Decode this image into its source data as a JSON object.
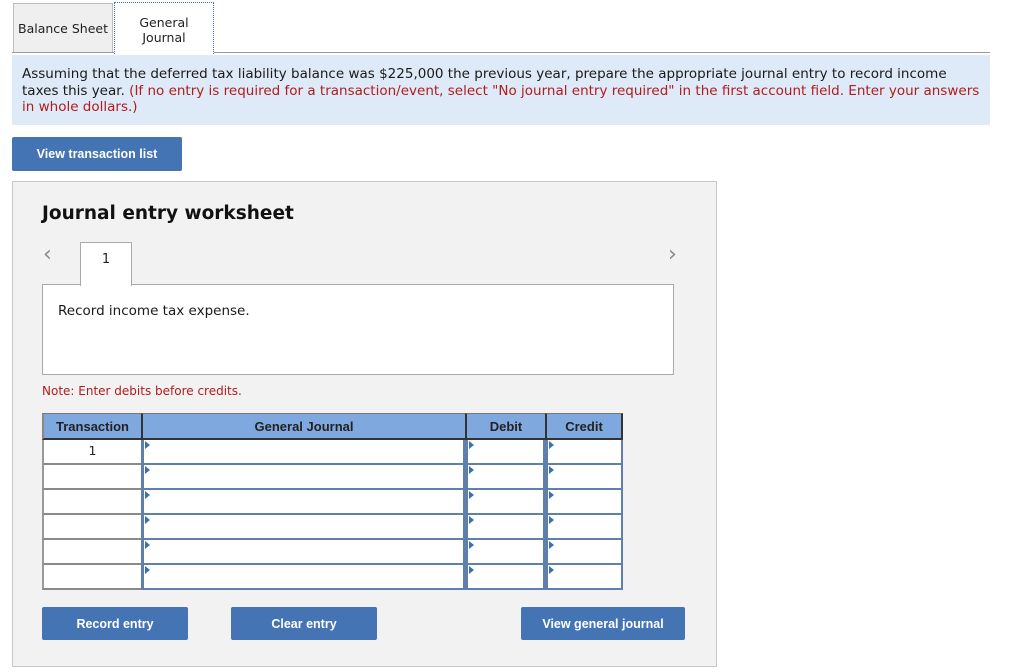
{
  "tabs": [
    {
      "label": "Balance Sheet",
      "active": false
    },
    {
      "label": "General\nJournal",
      "active": true
    }
  ],
  "instructions": {
    "text": "Assuming that the deferred tax liability balance was $225,000 the previous year, prepare the appropriate journal entry to record income taxes this year.",
    "hint": "(If no entry is required for a transaction/event, select \"No journal entry required\" in the first account field. Enter your answers in whole dollars.)"
  },
  "buttons": {
    "view_transaction_list": "View transaction list",
    "record_entry": "Record entry",
    "clear_entry": "Clear entry",
    "view_general_journal": "View general journal"
  },
  "worksheet": {
    "title": "Journal entry worksheet",
    "prev_icon": "chevron-left-icon",
    "next_icon": "chevron-right-icon",
    "current_entry": "1",
    "entry_description": "Record income tax expense.",
    "note": "Note: Enter debits before credits."
  },
  "table": {
    "headers": [
      "Transaction",
      "General Journal",
      "Debit",
      "Credit"
    ],
    "rows": [
      {
        "transaction": "1",
        "account": "",
        "debit": "",
        "credit": ""
      },
      {
        "transaction": "",
        "account": "",
        "debit": "",
        "credit": ""
      },
      {
        "transaction": "",
        "account": "",
        "debit": "",
        "credit": ""
      },
      {
        "transaction": "",
        "account": "",
        "debit": "",
        "credit": ""
      },
      {
        "transaction": "",
        "account": "",
        "debit": "",
        "credit": ""
      },
      {
        "transaction": "",
        "account": "",
        "debit": "",
        "credit": ""
      }
    ]
  },
  "colors": {
    "button_bg": "#4574b4",
    "header_bg": "#7fa8de",
    "instruction_bg": "#deeaf7",
    "hint_red": "#b31b1b"
  }
}
